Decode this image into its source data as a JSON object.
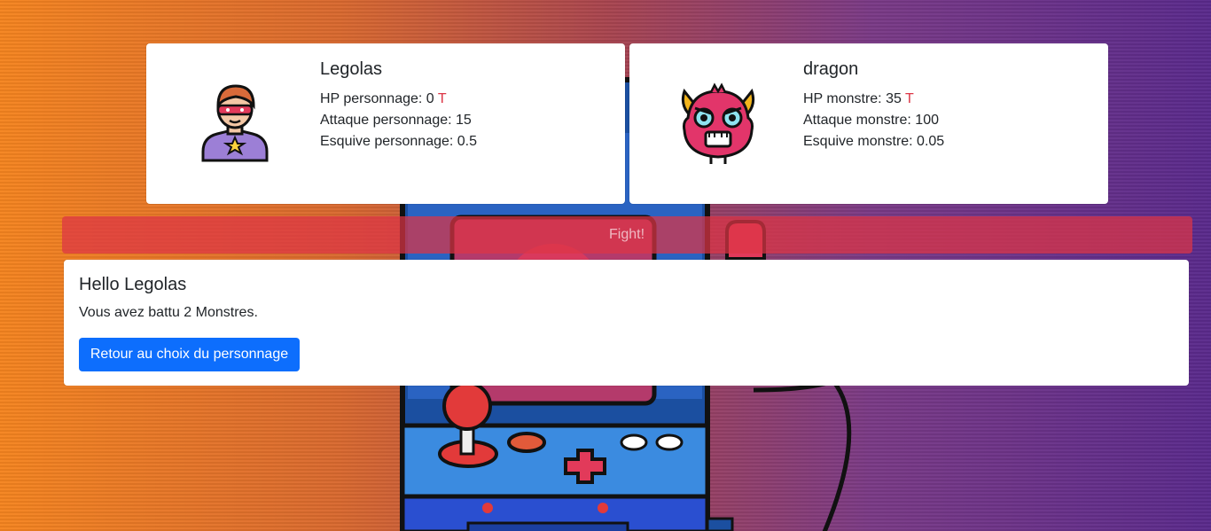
{
  "player": {
    "name": "Legolas",
    "hp_label": "HP personnage: 0",
    "hp_marker": "T",
    "attack_label": "Attaque personnage: 15",
    "dodge_label": "Esquive personnage: 0.5",
    "avatar_icon": "superhero-avatar-icon"
  },
  "monster": {
    "name": "dragon",
    "hp_label": "HP monstre: 35",
    "hp_marker": "T",
    "attack_label": "Attaque monstre: 100",
    "dodge_label": "Esquive monstre: 0.05",
    "avatar_icon": "monster-avatar-icon"
  },
  "fight": {
    "button_label": "Fight!"
  },
  "result": {
    "title": "Hello Legolas",
    "message": "Vous avez battu 2 Monstres.",
    "back_button_label": "Retour au choix du personnage"
  },
  "colors": {
    "primary": "#0d6efd",
    "danger": "#dc3545",
    "background_start": "#f5841f",
    "background_end": "#5a2a8c"
  }
}
